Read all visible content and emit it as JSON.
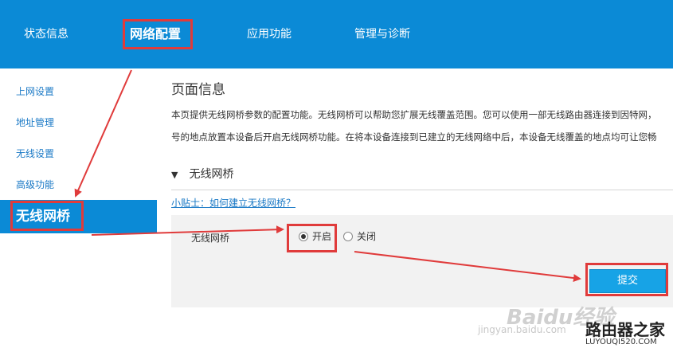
{
  "topnav": {
    "items": [
      {
        "label": "状态信息"
      },
      {
        "label": "网络配置"
      },
      {
        "label": "应用功能"
      },
      {
        "label": "管理与诊断"
      }
    ]
  },
  "sidebar": {
    "items": [
      {
        "label": "上网设置"
      },
      {
        "label": "地址管理"
      },
      {
        "label": "无线设置"
      },
      {
        "label": "高级功能"
      },
      {
        "label": "无线网桥"
      }
    ]
  },
  "main": {
    "title": "页面信息",
    "intro_line1": "本页提供无线网桥参数的配置功能。无线网桥可以帮助您扩展无线覆盖范围。您可以使用一部无线路由器连接到因特网，",
    "intro_line2": "号的地点放置本设备后开启无线网桥功能。在将本设备连接到已建立的无线网络中后，本设备无线覆盖的地点均可让您畅",
    "section_triangle": "▼",
    "section_title": "无线网桥",
    "tip_link": "小贴士：如何建立无线网桥？",
    "field_label": "无线网桥",
    "radio_on": "开启",
    "radio_off": "关闭",
    "submit": "提交"
  },
  "watermark": {
    "logo": "Baidu经验",
    "url": "jingyan.baidu.com",
    "site_logo": "路由器之家",
    "site_url": "LUYOUQI520.COM"
  },
  "colors": {
    "nav_blue": "#0b8ad6",
    "annotation_red": "#e03b3b",
    "button_blue": "#17a3e6"
  }
}
